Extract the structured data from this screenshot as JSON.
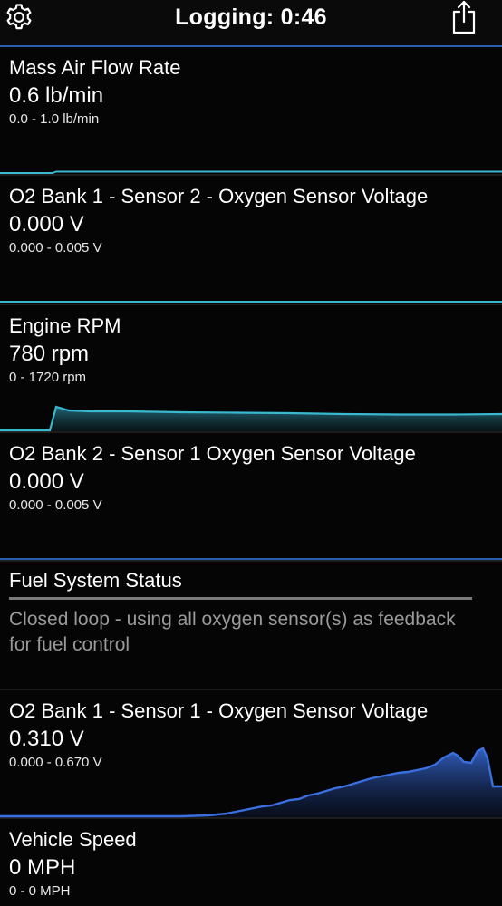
{
  "header": {
    "title": "Logging:  0:46",
    "settings_icon": "gear-icon",
    "share_icon": "share-icon"
  },
  "panels": [
    {
      "name": "Mass Air Flow Rate",
      "value": "0.6 lb/min",
      "range": "0.0 - 1.0 lb/min",
      "color": "#39b8cf"
    },
    {
      "name": "O2 Bank 1 - Sensor 2 - Oxygen Sensor Voltage",
      "value": "0.000 V",
      "range": "0.000 - 0.005 V",
      "color": "#39b8cf"
    },
    {
      "name": "Engine RPM",
      "value": "780 rpm",
      "range": "0 - 1720 rpm",
      "color": "#39b8cf"
    },
    {
      "name": "O2 Bank 2 - Sensor 1 Oxygen Sensor Voltage",
      "value": "0.000 V",
      "range": "0.000 - 0.005 V",
      "color": "#2a5fb0"
    },
    {
      "name": "Fuel System Status",
      "description": "Closed loop - using all oxygen sensor(s) as feedback for fuel control"
    },
    {
      "name": "O2 Bank 1 - Sensor 1 - Oxygen Sensor Voltage",
      "value": "0.310 V",
      "range": "0.000 - 0.670 V",
      "color": "#3a6fe0"
    },
    {
      "name": "Vehicle Speed",
      "value": "0 MPH",
      "range": "0 - 0 MPH",
      "color": "#2a5fb0"
    }
  ],
  "colors": {
    "accent": "#2a5fb0",
    "graph_cyan": "#39b8cf",
    "graph_blue": "#3a6fe0"
  }
}
